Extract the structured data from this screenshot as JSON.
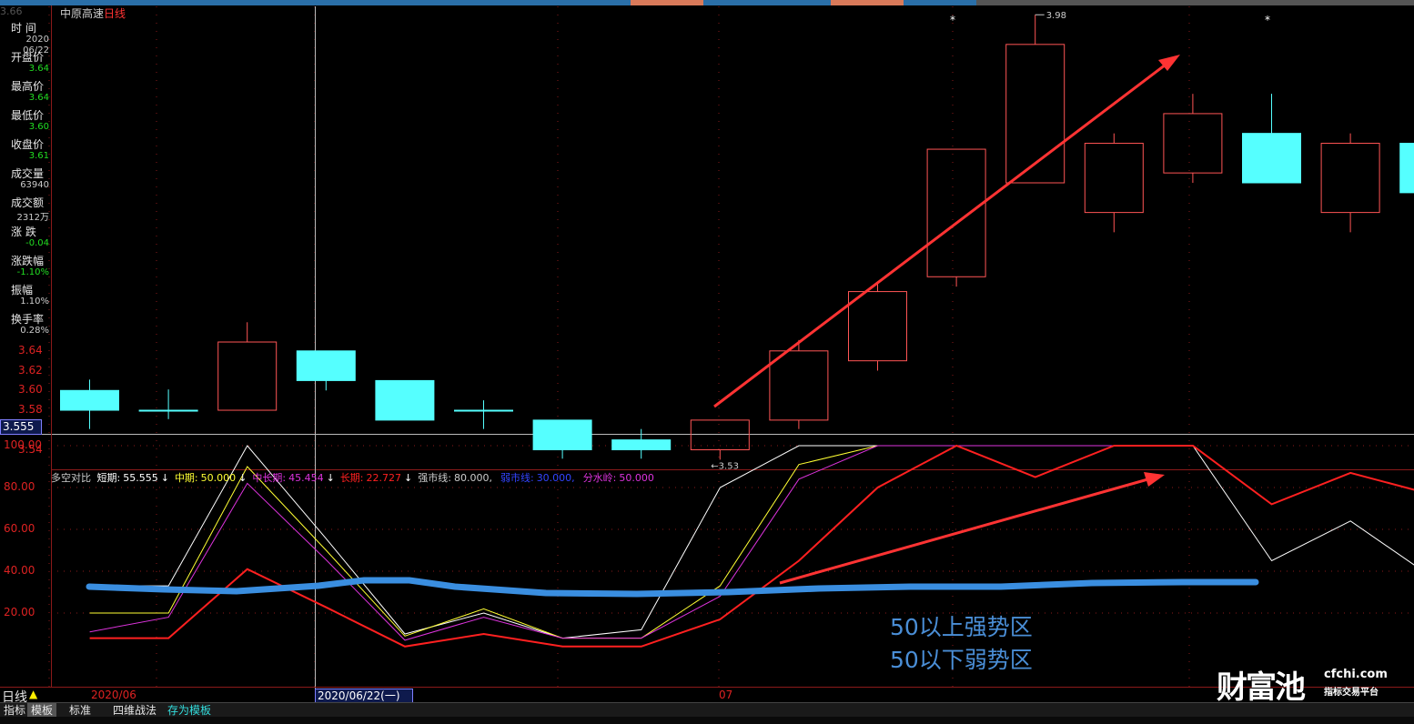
{
  "top_bar_colors": [
    "#2a6fa8",
    "#d97a5a",
    "#2a6fa8",
    "#d97a5a",
    "#2a6fa8",
    "#555555"
  ],
  "stock": {
    "name": "中原高速",
    "period": "日线"
  },
  "info_panel": {
    "price_top": "3.66",
    "items": [
      {
        "label": "时  间",
        "values": [
          "2020",
          "06/22"
        ],
        "color": "#cccccc"
      },
      {
        "label": "开盘价",
        "values": [
          "3.64"
        ],
        "color": "#22dd22"
      },
      {
        "label": "最高价",
        "values": [
          "3.64"
        ],
        "color": "#22dd22"
      },
      {
        "label": "最低价",
        "values": [
          "3.60"
        ],
        "color": "#22dd22"
      },
      {
        "label": "收盘价",
        "values": [
          "3.61"
        ],
        "color": "#22dd22"
      },
      {
        "label": "成交量",
        "values": [
          "63940"
        ],
        "color": "#cccccc"
      },
      {
        "label": "成交额",
        "values": [
          "2312万"
        ],
        "color": "#cccccc"
      },
      {
        "label": "涨  跌",
        "values": [
          "-0.04"
        ],
        "color": "#22dd22"
      },
      {
        "label": "涨跌幅",
        "values": [
          "-1.10%"
        ],
        "color": "#22dd22"
      },
      {
        "label": "振幅",
        "values": [
          "1.10%"
        ],
        "color": "#cccccc"
      },
      {
        "label": "换手率",
        "values": [
          "0.28%"
        ],
        "color": "#cccccc"
      }
    ]
  },
  "price_axis": [
    "3.64",
    "3.62",
    "3.60",
    "3.58",
    "3.54"
  ],
  "crosshair": {
    "price": "3.555",
    "date": "2020/06/22(一)"
  },
  "price_labels": {
    "high": "3.98",
    "low": "3.53"
  },
  "chart_data": [
    {
      "type": "candlestick",
      "y_unit": "price",
      "candles": [
        {
          "open": 3.6,
          "close": 3.58,
          "high": 3.611,
          "low": 3.561
        },
        {
          "open": 3.58,
          "close": 3.58,
          "high": 3.601,
          "low": 3.571
        },
        {
          "open": 3.58,
          "close": 3.649,
          "high": 3.669,
          "low": 3.58
        },
        {
          "open": 3.64,
          "close": 3.61,
          "high": 3.64,
          "low": 3.6
        },
        {
          "open": 3.61,
          "close": 3.57,
          "high": 3.61,
          "low": 3.57
        },
        {
          "open": 3.58,
          "close": 3.58,
          "high": 3.59,
          "low": 3.561
        },
        {
          "open": 3.57,
          "close": 3.54,
          "high": 3.57,
          "low": 3.531
        },
        {
          "open": 3.55,
          "close": 3.54,
          "high": 3.561,
          "low": 3.531
        },
        {
          "open": 3.54,
          "close": 3.57,
          "high": 3.57,
          "low": 3.53
        },
        {
          "open": 3.57,
          "close": 3.64,
          "high": 3.651,
          "low": 3.561
        },
        {
          "open": 3.63,
          "close": 3.7,
          "high": 3.71,
          "low": 3.62
        },
        {
          "open": 3.715,
          "close": 3.844,
          "high": 3.844,
          "low": 3.705
        },
        {
          "open": 3.81,
          "close": 3.95,
          "high": 3.98,
          "low": 3.81
        },
        {
          "open": 3.78,
          "close": 3.85,
          "high": 3.86,
          "low": 3.76
        },
        {
          "open": 3.82,
          "close": 3.88,
          "high": 3.9,
          "low": 3.81
        },
        {
          "open": 3.86,
          "close": 3.81,
          "high": 3.9,
          "low": 3.81
        },
        {
          "open": 3.78,
          "close": 3.85,
          "high": 3.86,
          "low": 3.76
        },
        {
          "open": 3.85,
          "close": 3.8,
          "high": 3.85,
          "low": 3.8
        }
      ]
    },
    {
      "type": "line",
      "title": "多空对比",
      "ylim": [
        0,
        100
      ],
      "y_ticks": [
        "100.00",
        "80.00",
        "60.00",
        "40.00",
        "20.00"
      ],
      "series": [
        {
          "name": "短期",
          "color": "#ffffff",
          "values": [
            null,
            33,
            33,
            100,
            55.555,
            10,
            20,
            8,
            12,
            80,
            100,
            100,
            100,
            100,
            100,
            100,
            45,
            64,
            38
          ]
        },
        {
          "name": "中期",
          "color": "#ffff33",
          "values": [
            null,
            20,
            20,
            90,
            50.0,
            9,
            22,
            8,
            8,
            33,
            91,
            100,
            100,
            100,
            100,
            100,
            null,
            null,
            null
          ]
        },
        {
          "name": "中长期",
          "color": "#dd33dd",
          "values": [
            null,
            11,
            18,
            82,
            45.454,
            7,
            18,
            8,
            8,
            28,
            84,
            100,
            100,
            100,
            100,
            100,
            null,
            null,
            null
          ]
        },
        {
          "name": "长期",
          "color": "#ff2020",
          "values": [
            null,
            8,
            8,
            41,
            22.727,
            4,
            10,
            4,
            4,
            17,
            45,
            80,
            100,
            85,
            100,
            100,
            72,
            87,
            77
          ]
        }
      ]
    }
  ],
  "indicator_legend": {
    "name": "多空对比",
    "items": [
      {
        "label": "短期:",
        "value": "55.555",
        "arrow": "↓",
        "color": "#ffffff"
      },
      {
        "label": "中期:",
        "value": "50.000",
        "arrow": "↓",
        "color": "#ffff33"
      },
      {
        "label": "中长期:",
        "value": "45.454",
        "arrow": "↓",
        "color": "#dd33dd"
      },
      {
        "label": "长期:",
        "value": "22.727",
        "arrow": "↓",
        "color": "#ff2020"
      },
      {
        "label": "强市线:",
        "value": "80.000,",
        "arrow": "",
        "color": "#cccccc"
      },
      {
        "label": "弱市线:",
        "value": "30.000,",
        "arrow": "",
        "color": "#3344ff"
      },
      {
        "label": "分水岭:",
        "value": "50.000",
        "arrow": "",
        "color": "#dd33dd"
      }
    ]
  },
  "annotations": [
    "50以上强势区",
    "50以下弱势区"
  ],
  "date_axis": [
    "2020/06",
    "07"
  ],
  "bottom_label": "日线",
  "tabs": [
    "指标",
    "模板",
    "标准",
    "四维战法",
    "存为模板"
  ],
  "watermark": {
    "main": "财富池",
    "url": "cfchi.com",
    "sub": "指标交易平台"
  }
}
